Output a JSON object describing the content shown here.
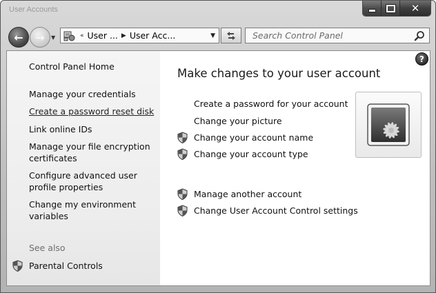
{
  "window": {
    "title": "User Accounts",
    "controls": {
      "minimize": "minimize",
      "maximize": "maximize",
      "close": "close"
    }
  },
  "navbar": {
    "breadcrumb_prefix": "«",
    "crumbs": [
      "User ...",
      "User Acc..."
    ],
    "search_placeholder": "Search Control Panel"
  },
  "left_pane": {
    "home": "Control Panel Home",
    "links": [
      "Manage your credentials",
      "Create a password reset disk",
      "Link online IDs",
      "Manage your file encryption certificates",
      "Configure advanced user profile properties",
      "Change my environment variables"
    ],
    "see_also": "See also",
    "parental_controls": "Parental Controls"
  },
  "main": {
    "title": "Make changes to your user account",
    "tasks": [
      {
        "label": "Create a password for your account",
        "shield": false
      },
      {
        "label": "Change your picture",
        "shield": false
      },
      {
        "label": "Change your account name",
        "shield": true
      },
      {
        "label": "Change your account type",
        "shield": true
      }
    ],
    "other_tasks": [
      {
        "label": "Manage another account",
        "shield": true
      },
      {
        "label": "Change User Account Control settings",
        "shield": true
      }
    ]
  },
  "icons": {
    "help": "help-icon",
    "shield": "uac-shield-icon",
    "search": "search-icon",
    "refresh": "refresh-icon",
    "user_picture": "flower-picture-icon"
  }
}
